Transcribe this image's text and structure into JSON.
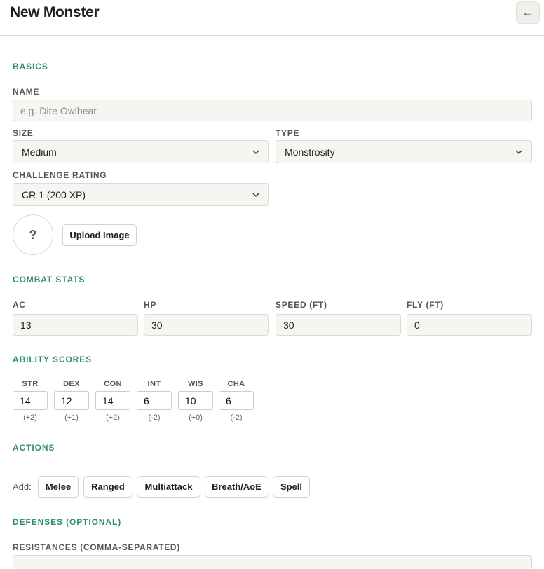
{
  "header": {
    "title": "New Monster",
    "back_icon": "arrow-left-icon",
    "back_glyph": "←"
  },
  "basics": {
    "section_title": "BASICS",
    "name_label": "NAME",
    "name_placeholder": "e.g. Dire Owlbear",
    "size_label": "SIZE",
    "size_value": "Medium",
    "type_label": "TYPE",
    "type_value": "Monstrosity",
    "cr_label": "CHALLENGE RATING",
    "cr_value": "CR 1 (200 XP)",
    "avatar_placeholder": "?",
    "upload_label": "Upload Image"
  },
  "combat": {
    "section_title": "COMBAT STATS",
    "fields": [
      {
        "label": "AC",
        "value": "13"
      },
      {
        "label": "HP",
        "value": "30"
      },
      {
        "label": "SPEED (FT)",
        "value": "30"
      },
      {
        "label": "FLY (FT)",
        "value": "0"
      }
    ]
  },
  "abilities": {
    "section_title": "ABILITY SCORES",
    "scores": [
      {
        "label": "STR",
        "value": "14",
        "mod": "(+2)"
      },
      {
        "label": "DEX",
        "value": "12",
        "mod": "(+1)"
      },
      {
        "label": "CON",
        "value": "14",
        "mod": "(+2)"
      },
      {
        "label": "INT",
        "value": "6",
        "mod": "(-2)"
      },
      {
        "label": "WIS",
        "value": "10",
        "mod": "(+0)"
      },
      {
        "label": "CHA",
        "value": "6",
        "mod": "(-2)"
      }
    ]
  },
  "actions": {
    "section_title": "ACTIONS",
    "add_label": "Add:",
    "buttons": [
      "Melee",
      "Ranged",
      "Multiattack",
      "Breath/AoE",
      "Spell"
    ]
  },
  "defenses": {
    "section_title": "DEFENSES (OPTIONAL)",
    "resistances_label": "RESISTANCES (COMMA-SEPARATED)"
  },
  "colors": {
    "accent": "#2e8b7a",
    "field_bg": "#f6f5f2"
  }
}
